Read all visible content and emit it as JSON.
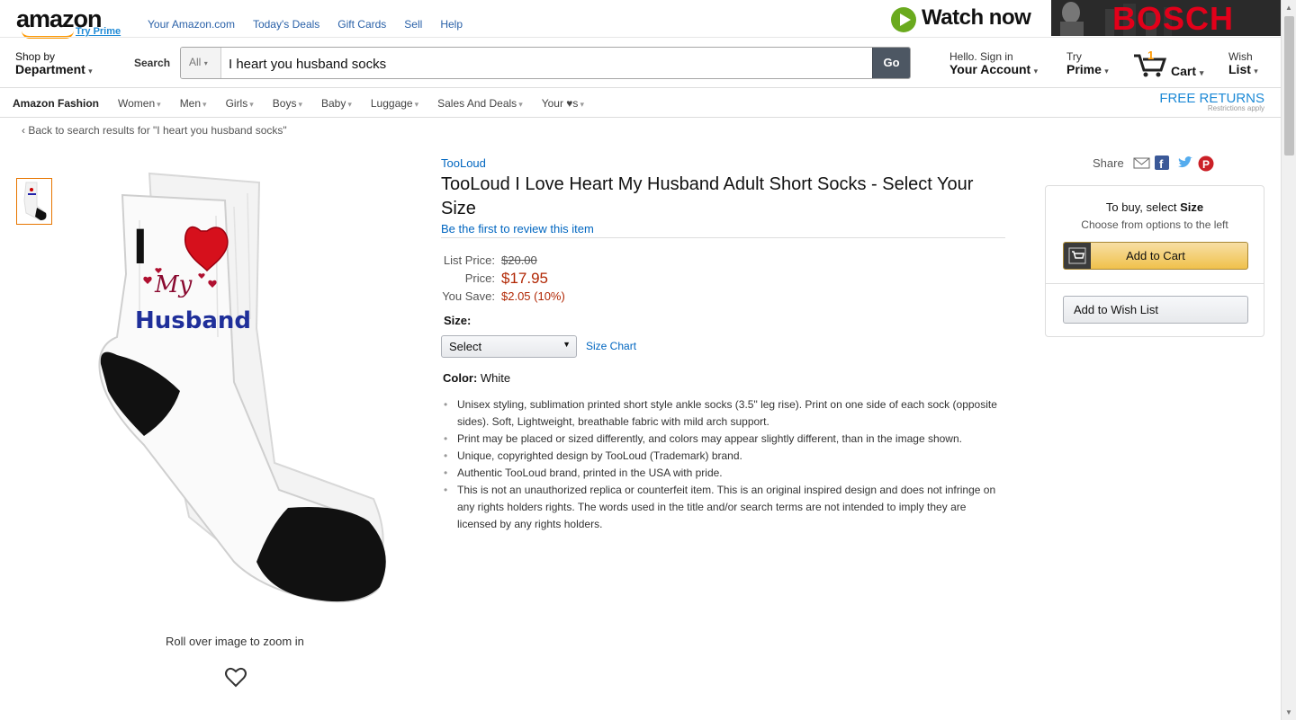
{
  "header": {
    "logo_text": "amazon",
    "try_prime": "Try Prime",
    "top_links": [
      "Your Amazon.com",
      "Today's Deals",
      "Gift Cards",
      "Sell",
      "Help"
    ],
    "ad": {
      "watch_now": "Watch now",
      "brand": "BOSCH"
    }
  },
  "nav": {
    "shop_by": "Shop by",
    "department": "Department",
    "search_label": "Search",
    "search_scope": "All",
    "search_value": "I heart you husband socks",
    "go_button": "Go",
    "account_line1": "Hello. Sign in",
    "account_line2": "Your Account",
    "prime_line1": "Try",
    "prime_line2": "Prime",
    "cart_count": "1",
    "cart_label": "Cart",
    "wish_line1": "Wish",
    "wish_line2": "List"
  },
  "subnav": {
    "items": [
      "Amazon Fashion",
      "Women",
      "Men",
      "Girls",
      "Boys",
      "Baby",
      "Luggage",
      "Sales And Deals",
      "Your ♥s"
    ],
    "free_returns": "FREE RETURNS",
    "restrictions": "Restrictions apply"
  },
  "breadcrumb": "‹ Back to search results for \"I heart you husband socks\"",
  "product": {
    "brand": "TooLoud",
    "title": "TooLoud I Love Heart My Husband Adult Short Socks - Select Your Size",
    "review_link": "Be the first to review this item",
    "list_price_label": "List Price:",
    "list_price": "$20.00",
    "price_label": "Price:",
    "price": "$17.95",
    "save_label": "You Save:",
    "save_value": "$2.05 (10%)",
    "size_label": "Size:",
    "size_select": "Select",
    "size_chart": "Size Chart",
    "color_label": "Color:",
    "color_value": "White",
    "bullets": [
      "Unisex styling, sublimation printed short style ankle socks (3.5\" leg rise). Print on one side of each sock (opposite sides). Soft, Lightweight, breathable fabric with mild arch support.",
      "Print may be placed or sized differently, and colors may appear slightly different, than in the image shown.",
      "Unique, copyrighted design by TooLoud (Trademark) brand.",
      "Authentic TooLoud brand, printed in the USA with pride.",
      "This is not an unauthorized replica or counterfeit item. This is an original inspired design and does not infringe on any rights holders rights. The words used in the title and/or search terms are not intended to imply they are licensed by any rights holders."
    ],
    "image_text": {
      "i": "I",
      "my": "My",
      "husband": "Husband"
    },
    "rollover": "Roll over image to zoom in"
  },
  "buybox": {
    "share": "Share",
    "to_buy": "To buy, select ",
    "size_word": "Size",
    "choose": "Choose from options to the left",
    "add_to_cart": "Add to Cart",
    "add_to_wish": "Add to Wish List"
  },
  "colors": {
    "accent_orange": "#f90",
    "link": "#0066c0",
    "price_red": "#b12704",
    "bosch_red": "#e2001a"
  }
}
